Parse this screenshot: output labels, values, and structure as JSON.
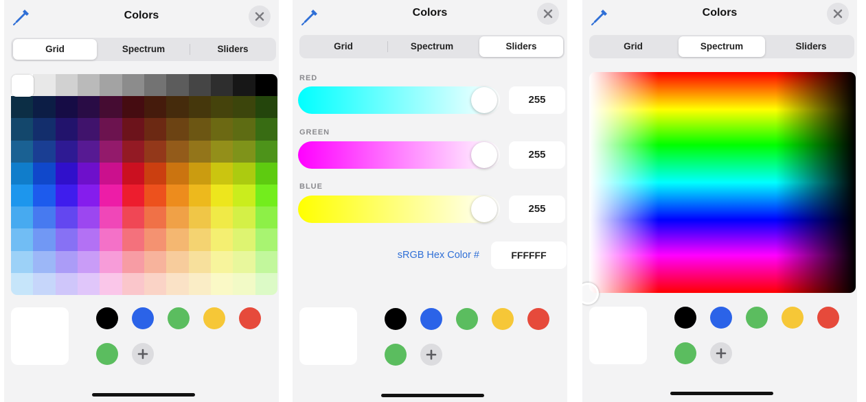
{
  "header": {
    "title": "Colors"
  },
  "tabs": [
    "Grid",
    "Spectrum",
    "Sliders"
  ],
  "panels": {
    "grid": {
      "active_tab": "Grid"
    },
    "sliders": {
      "active_tab": "Sliders"
    },
    "spectrum": {
      "active_tab": "Spectrum"
    }
  },
  "sliders": {
    "red": {
      "label": "RED",
      "value": "255"
    },
    "green": {
      "label": "GREEN",
      "value": "255"
    },
    "blue": {
      "label": "BLUE",
      "value": "255"
    },
    "hex_label": "sRGB Hex Color #",
    "hex_value": "FFFFFF"
  },
  "current_color": "#ffffff",
  "saved_swatches": [
    {
      "name": "black",
      "color": "#000000"
    },
    {
      "name": "blue",
      "color": "#2b63e8"
    },
    {
      "name": "green",
      "color": "#5bbd5f"
    },
    {
      "name": "yellow",
      "color": "#f6c737"
    },
    {
      "name": "red",
      "color": "#e64a3b"
    },
    {
      "name": "green",
      "color": "#5bbd5f"
    }
  ],
  "icons": {
    "eyedropper": "eyedropper-icon",
    "close": "close-icon",
    "add": "plus-icon"
  },
  "accent_color": "#2f6fd6"
}
